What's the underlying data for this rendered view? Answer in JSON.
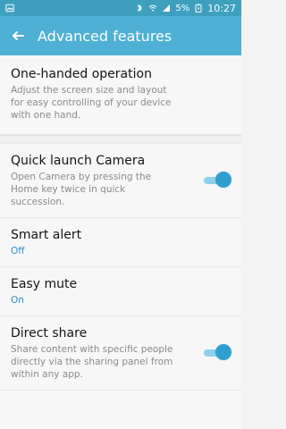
{
  "statusbar": {
    "battery_percent": "5%",
    "time": "10:27",
    "icons": [
      "gallery-icon",
      "bluetooth-icon",
      "wifi-icon",
      "signal-icon",
      "battery-charging-icon"
    ]
  },
  "appbar": {
    "title": "Advanced features",
    "back_icon": "arrow-left-icon"
  },
  "settings": [
    {
      "label": "One-handed operation",
      "description": "Adjust the screen size and layout for easy controlling of your device with one hand."
    },
    {
      "label": "Quick launch Camera",
      "description": "Open Camera by pressing the Home key twice in quick succession.",
      "toggle_on": true
    },
    {
      "label": "Smart alert",
      "value": "Off"
    },
    {
      "label": "Easy mute",
      "value": "On"
    },
    {
      "label": "Direct share",
      "description": "Share content with specific people directly via the sharing panel from within any app.",
      "toggle_on": true
    }
  ],
  "colors": {
    "appbar": "#4db0d4",
    "statusbar": "#3e9fbf",
    "accent_value": "#2f8fc7",
    "toggle_track": "#8fd0ea",
    "toggle_thumb": "#2f9fd0"
  }
}
